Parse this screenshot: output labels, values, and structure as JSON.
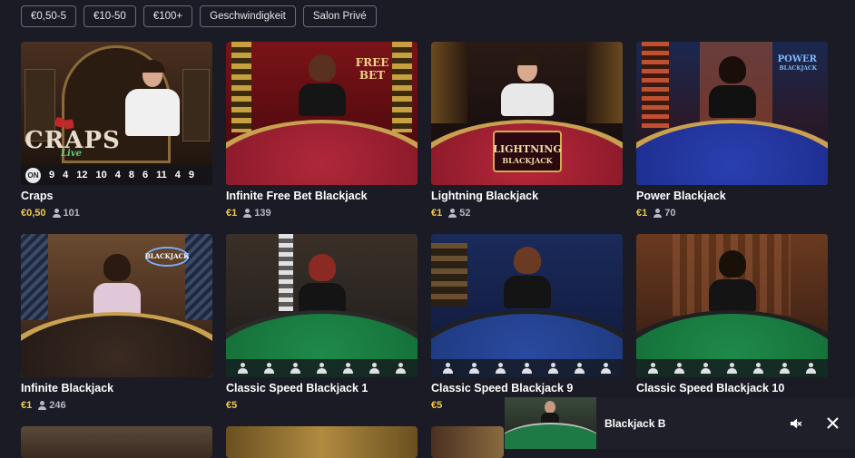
{
  "filters": [
    "€0,50-5",
    "€10-50",
    "€100+",
    "Geschwindigkeit",
    "Salon Privé"
  ],
  "games": [
    {
      "title": "Craps",
      "bet": "€0,50",
      "players": "101",
      "logo": "CRAPS",
      "logo_sub": "Live",
      "roulette_numbers": [
        "9",
        "4",
        "12",
        "10",
        "4",
        "8",
        "6",
        "11",
        "4",
        "9"
      ],
      "on_label": "ON"
    },
    {
      "title": "Infinite Free Bet Blackjack",
      "bet": "€1",
      "players": "139",
      "logo": "FREE BET"
    },
    {
      "title": "Lightning Blackjack",
      "bet": "€1",
      "players": "52",
      "logo": "LIGHTNING",
      "logo_sub": "BLACKJACK"
    },
    {
      "title": "Power Blackjack",
      "bet": "€1",
      "players": "70",
      "logo": "POWER",
      "logo_sub": "BLACKJACK"
    },
    {
      "title": "Infinite Blackjack",
      "bet": "€1",
      "players": "246",
      "logo": "BLACKJACK"
    },
    {
      "title": "Classic Speed Blackjack 1",
      "bet": "€5"
    },
    {
      "title": "Classic Speed Blackjack 9",
      "bet": "€5"
    },
    {
      "title": "Classic Speed Blackjack 10",
      "bet": ""
    }
  ],
  "mini_player": {
    "title": "Blackjack B"
  },
  "icons": {
    "players": "person-icon",
    "seat": "seat-icon",
    "mute": "speaker-muted-icon",
    "close": "close-icon"
  },
  "colors": {
    "background": "#1a1b24",
    "bet": "#f2c94c",
    "players": "#b7b9c4"
  }
}
